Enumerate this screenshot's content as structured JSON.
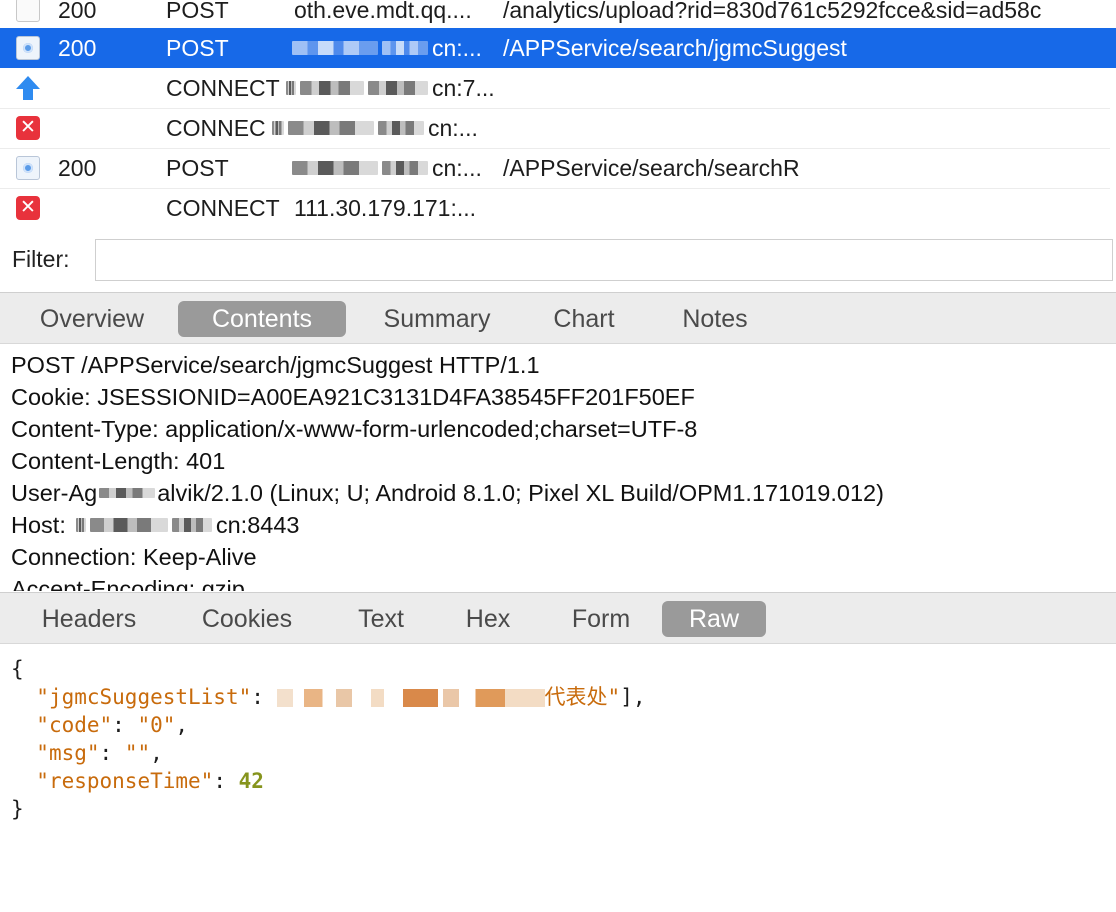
{
  "requests": [
    {
      "icon": "blank-icon",
      "status": "200",
      "method": "POST",
      "host_visible": "oth.eve.mdt.qq....",
      "path": "/analytics/upload?rid=830d761c5292fcce&sid=ad58c",
      "selected": false
    },
    {
      "icon": "document-icon",
      "status": "200",
      "method": "POST",
      "host_visible": "cn:...",
      "path": "/APPService/search/jgmcSuggest",
      "selected": true
    },
    {
      "icon": "upload-arrow-icon",
      "status": "",
      "method": "CONNECT",
      "host_visible": "cn:7...",
      "path": "",
      "selected": false
    },
    {
      "icon": "error-icon",
      "status": "",
      "method": "CONNEC",
      "host_visible": "cn:...",
      "path": "",
      "selected": false
    },
    {
      "icon": "document-icon",
      "status": "200",
      "method": "POST",
      "host_visible": "cn:...",
      "path": "/APPService/search/searchR",
      "selected": false
    },
    {
      "icon": "error-icon",
      "status": "",
      "method": "CONNECT",
      "host_visible": "111.30.179.171:...",
      "path": "",
      "selected": false
    }
  ],
  "filter": {
    "label": "Filter:",
    "value": ""
  },
  "inspector_tabs": {
    "items": [
      "Overview",
      "Contents",
      "Summary",
      "Chart",
      "Notes"
    ],
    "active": "Contents"
  },
  "request_raw": {
    "request_line": "POST /APPService/search/jgmcSuggest HTTP/1.1",
    "cookie": "Cookie: JSESSIONID=A00EA921C3131D4FA38545FF201F50EF",
    "content_type": "Content-Type: application/x-www-form-urlencoded;charset=UTF-8",
    "content_length": "Content-Length: 401",
    "user_agent_prefix": "User-Ag",
    "user_agent_rest": "alvik/2.1.0 (Linux; U; Android 8.1.0; Pixel XL Build/OPM1.171019.012)",
    "host_prefix": "Host:",
    "host_suffix": "cn:8443",
    "connection": "Connection: Keep-Alive",
    "accept_encoding": "Accept-Encoding: gzip"
  },
  "response_tabs": {
    "items": [
      "Headers",
      "Cookies",
      "Text",
      "Hex",
      "Form",
      "Raw"
    ],
    "active": "Raw"
  },
  "response_json": {
    "open_brace": "{",
    "close_brace": "}",
    "k1": "\"jgmcSuggestList\"",
    "v1_tail": "代表处\"",
    "v1_close": "],",
    "k2": "\"code\"",
    "v2": "\"0\"",
    "k3": "\"msg\"",
    "v3": "\"\"",
    "k4": "\"responseTime\"",
    "v4": "42"
  },
  "colors": {
    "selection": "#1769e8",
    "json_key": "#c86b0c",
    "json_number": "#86941d",
    "active_tab": "#9a9a9a"
  }
}
